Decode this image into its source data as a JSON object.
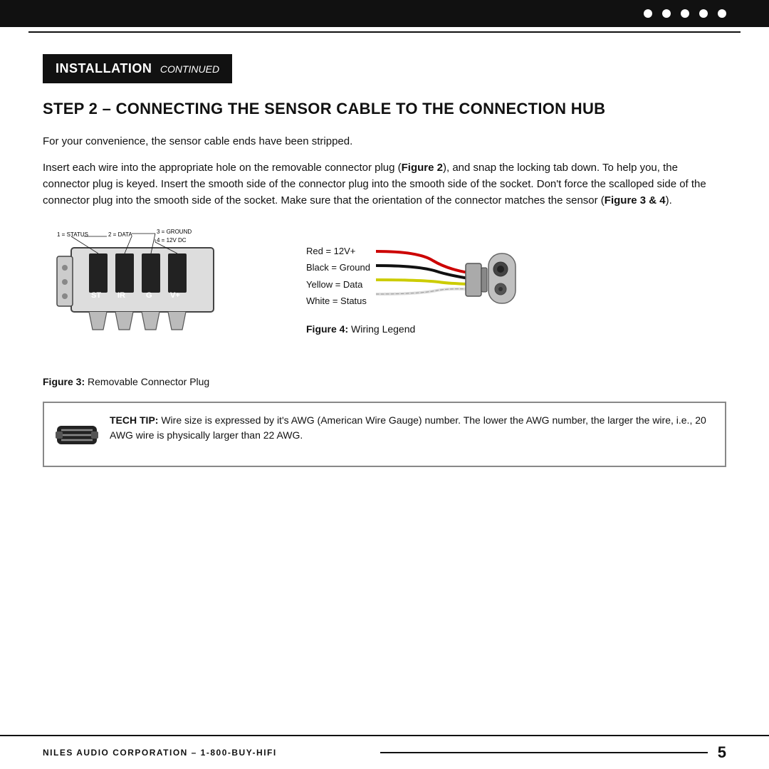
{
  "topbar": {
    "dots_count": 5
  },
  "header": {
    "installation_label": "INSTALLATION",
    "continued_label": "CONTINUED"
  },
  "step": {
    "title": "STEP 2 – CONNECTING THE SENSOR CABLE TO THE CONNECTION HUB"
  },
  "paragraphs": {
    "p1": "For your convenience, the sensor cable ends have been stripped.",
    "p2_start": "Insert each wire into the appropriate hole on the removable connector plug (",
    "p2_figure": "Figure 2",
    "p2_end": "), and snap the locking tab down. To help you, the connector plug is keyed. Insert the smooth side of the connector plug into the smooth side of the socket. Don't force the scalloped side of the connector plug into the smooth side of the socket. Make sure that the orientation of the connector matches the sensor (",
    "p2_figure2": "Figure 3 & 4",
    "p2_end2": ")."
  },
  "figure3": {
    "label": "Figure 3:",
    "caption": "Removable Connector Plug",
    "diagram_labels": {
      "status": "1 = STATUS",
      "data": "2 = DATA",
      "ground": "3 = GROUND",
      "power": "4 = 12V DC",
      "st": "ST",
      "ir": "IR",
      "g": "G",
      "vplus": "V+"
    }
  },
  "figure4": {
    "label": "Figure 4:",
    "caption": "Wiring Legend",
    "wires": [
      {
        "color": "#e00",
        "label": "Red = 12V+"
      },
      {
        "color": "#111",
        "label": "Black = Ground"
      },
      {
        "color": "#cccc00",
        "label": "Yellow = Data"
      },
      {
        "color": "#fff",
        "label": "White = Status",
        "border": "#111"
      }
    ]
  },
  "tech_tip": {
    "bold_label": "TECH TIP:",
    "text": " Wire size is expressed by it's AWG (American Wire Gauge) number. The lower the AWG number, the larger the wire, i.e., 20 AWG wire is physically larger than 22 AWG."
  },
  "footer": {
    "company": "NILES AUDIO CORPORATION – 1-800-BUY-HIFI",
    "page_number": "5"
  }
}
